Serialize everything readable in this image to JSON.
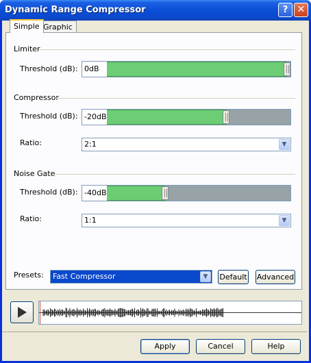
{
  "window": {
    "title": "Dynamic Range Compressor",
    "help_glyph": "?",
    "close_glyph": "✕"
  },
  "tabs": [
    {
      "label": "Simple",
      "active": true
    },
    {
      "label": "Graphic",
      "active": false
    }
  ],
  "limiter": {
    "group": "Limiter",
    "threshold_label": "Threshold (dB):",
    "threshold_value": "0dB",
    "threshold_fraction": 1.0
  },
  "compressor": {
    "group": "Compressor",
    "threshold_label": "Threshold (dB):",
    "threshold_value": "-20dB",
    "threshold_fraction": 0.708,
    "ratio_label": "Ratio:",
    "ratio_value": "2:1"
  },
  "noise_gate": {
    "group": "Noise Gate",
    "threshold_label": "Threshold (dB):",
    "threshold_value": "-40dB",
    "threshold_fraction": 0.415,
    "ratio_label": "Ratio:",
    "ratio_value": "1:1"
  },
  "presets": {
    "label": "Presets:",
    "value": "Fast Compressor",
    "default_button": "Default",
    "advanced_button": "Advanced"
  },
  "footer": {
    "apply": "Apply",
    "cancel": "Cancel",
    "help": "Help"
  },
  "icons": {
    "play": "play-icon",
    "dropdown": "chevron-down-icon"
  },
  "colors": {
    "fill": "#6dcd74",
    "title_bar": "#0a4fd7",
    "preset_highlight": "#0a48cc"
  }
}
